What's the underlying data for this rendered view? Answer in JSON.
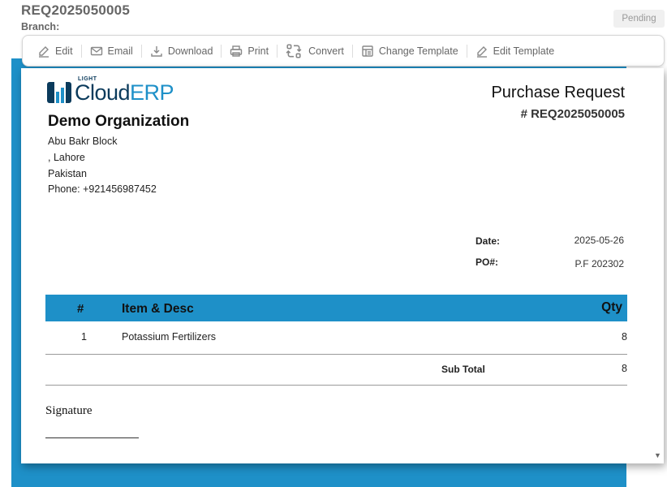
{
  "header": {
    "title": "REQ2025050005",
    "branch_label": "Branch:",
    "status": "Pending"
  },
  "toolbar": {
    "buttons": [
      {
        "label": "Edit",
        "icon": "edit-icon"
      },
      {
        "label": "Email",
        "icon": "email-icon"
      },
      {
        "label": "Download",
        "icon": "download-icon"
      },
      {
        "label": "Print",
        "icon": "print-icon"
      },
      {
        "label": "Convert",
        "icon": "convert-icon"
      },
      {
        "label": "Change Template",
        "icon": "template-icon"
      },
      {
        "label": "Edit Template",
        "icon": "edit-icon"
      }
    ]
  },
  "document": {
    "logo": {
      "light": "LIGHT",
      "cloud": "Cloud",
      "erp": "ERP",
      "brand_dark": "#0b3b5c",
      "brand_blue": "#1e90c8"
    },
    "organization": {
      "name": "Demo Organization",
      "address_1": "Abu Bakr Block",
      "address_2": ", Lahore",
      "country": "Pakistan",
      "phone": "Phone: +921456987452"
    },
    "title": "Purchase Request",
    "number": "# REQ2025050005",
    "date_label": "Date:",
    "date_value": "2025-05-26",
    "po_label": "PO#:",
    "po_value": "P.F 202302",
    "table": {
      "headers": {
        "num": "#",
        "item": "Item & Desc",
        "qty": "Qty"
      },
      "rows": [
        {
          "num": "1",
          "item": "Potassium Fertilizers",
          "qty": "8"
        }
      ],
      "subtotal_label": "Sub Total",
      "subtotal_value": "8"
    },
    "signature_label": "Signature"
  },
  "colors": {
    "accent": "#1e90c8",
    "status_bg": "#f0f0f0"
  }
}
